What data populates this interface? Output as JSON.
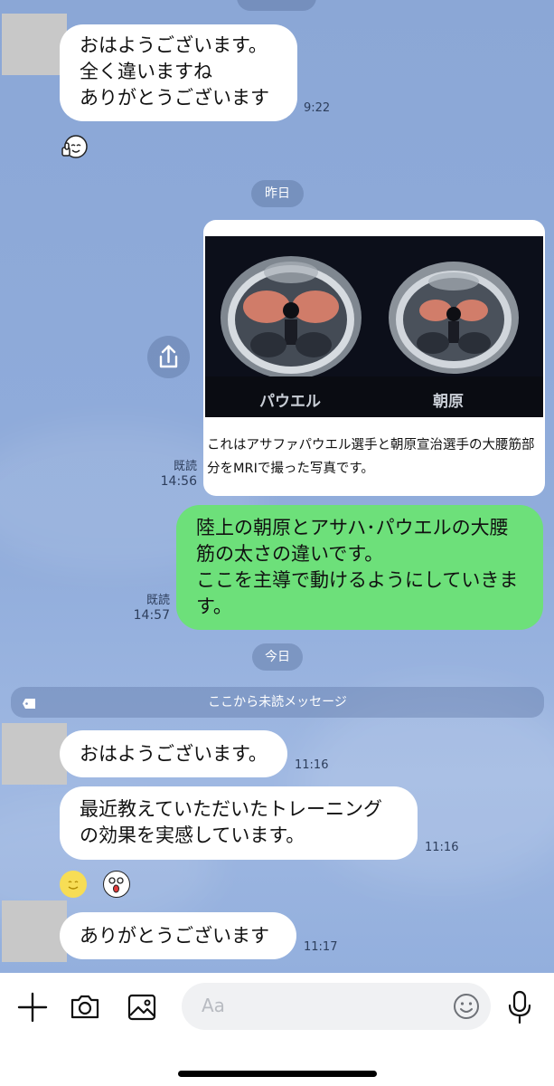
{
  "messages": {
    "m1_text": "おはようございます。\n全く違いますね\nありがとうございます",
    "m1_time": "9:22",
    "date_yesterday": "昨日",
    "image_labels": {
      "left": "パウエル",
      "right": "朝原"
    },
    "image_caption": "これはアサファパウエル選手と朝原宣治選手の大腰筋部分をMRIで撮った写真です。",
    "m2_read": "既読",
    "m2_time": "14:56",
    "m3_text": "陸上の朝原とアサハ･パウエルの大腰筋の太さの違いです。\nここを主導で動けるようにしていきます。",
    "m3_read": "既読",
    "m3_time": "14:57",
    "date_today": "今日",
    "unread_divider": "ここから未読メッセージ",
    "m4_text": "おはようございます。",
    "m4_time": "11:16",
    "m5_text": "最近教えていただいたトレーニング\nの効果を実感しています。",
    "m5_time": "11:16",
    "m6_text": "ありがとうございます",
    "m6_time": "11:17"
  },
  "input": {
    "placeholder": "Aa"
  },
  "icons": {
    "plus": "plus-icon",
    "camera": "camera-icon",
    "image": "image-icon",
    "emoji": "emoji-icon",
    "mic": "mic-icon",
    "share": "share-icon"
  },
  "colors": {
    "incoming_bubble": "#ffffff",
    "outgoing_bubble": "#6de07a",
    "chat_bg": "#8ea9d8"
  }
}
